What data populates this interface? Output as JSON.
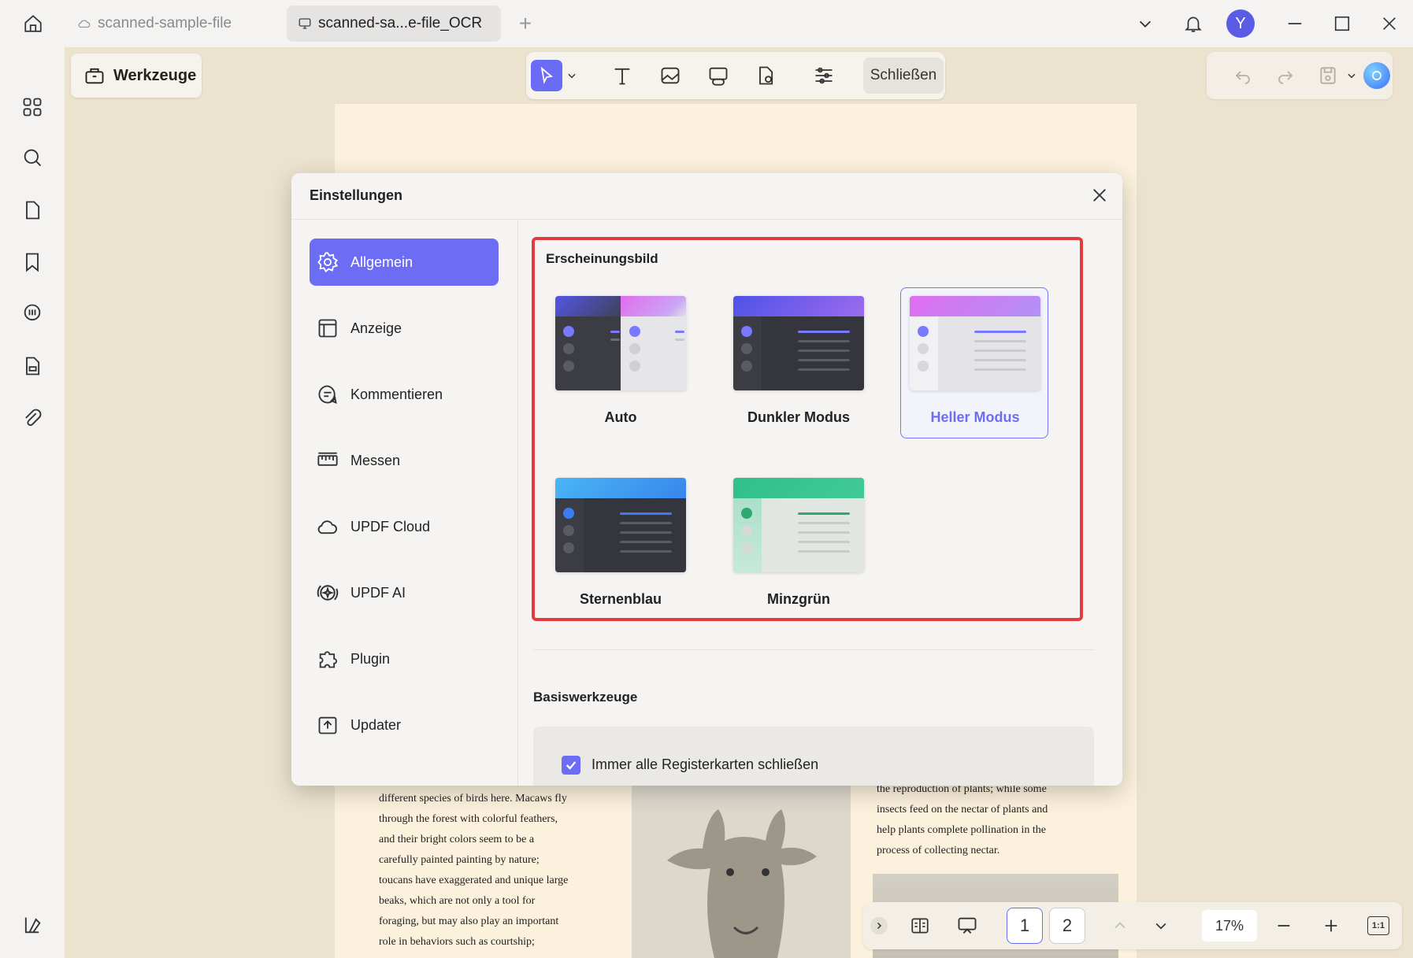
{
  "tabs": [
    {
      "label": "scanned-sample-file",
      "icon": "cloud-icon"
    },
    {
      "label": "scanned-sa...e-file_OCR",
      "icon": "monitor-icon"
    }
  ],
  "user": {
    "avatar_initial": "Y"
  },
  "toolbar": {
    "werkzeuge_label": "Werkzeuge",
    "close_label": "Schließen"
  },
  "settings": {
    "title": "Einstellungen",
    "nav": [
      {
        "label": "Allgemein",
        "icon": "gear-icon",
        "active": true
      },
      {
        "label": "Anzeige",
        "icon": "layout-icon"
      },
      {
        "label": "Kommentieren",
        "icon": "comment-icon"
      },
      {
        "label": "Messen",
        "icon": "ruler-icon"
      },
      {
        "label": "UPDF Cloud",
        "icon": "cloud-icon"
      },
      {
        "label": "UPDF AI",
        "icon": "ai-icon"
      },
      {
        "label": "Plugin",
        "icon": "puzzle-icon"
      },
      {
        "label": "Updater",
        "icon": "update-icon"
      }
    ],
    "appearance": {
      "title": "Erscheinungsbild",
      "themes": [
        {
          "label": "Auto",
          "selected": false
        },
        {
          "label": "Dunkler Modus",
          "selected": false
        },
        {
          "label": "Heller Modus",
          "selected": true
        },
        {
          "label": "Sternenblau",
          "selected": false
        },
        {
          "label": "Minzgrün",
          "selected": false
        }
      ]
    },
    "basic_tools": {
      "title": "Basiswerkzeuge",
      "option_label": "Immer alle Registerkarten schließen",
      "option_checked": true
    }
  },
  "document": {
    "left_column": [
      "different species of birds here. Macaws fly",
      "through the forest with colorful feathers,",
      "and their bright colors seem to be a",
      "carefully painted painting by nature;",
      "toucans have exaggerated and unique large",
      "beaks, which are not only a tool for",
      "foraging, but may also play an important",
      "role in behaviors such as courtship;"
    ],
    "right_column": [
      "the reproduction of plants; while some",
      "insects feed on the nectar of plants and",
      "help plants complete pollination in the",
      "process of collecting nectar."
    ]
  },
  "navigation": {
    "pages": [
      "1",
      "2"
    ],
    "current_page": "1",
    "zoom": "17%",
    "fit_label": "1:1"
  },
  "colors": {
    "accent": "#6c6df4",
    "highlight_border": "#e33b3b"
  }
}
